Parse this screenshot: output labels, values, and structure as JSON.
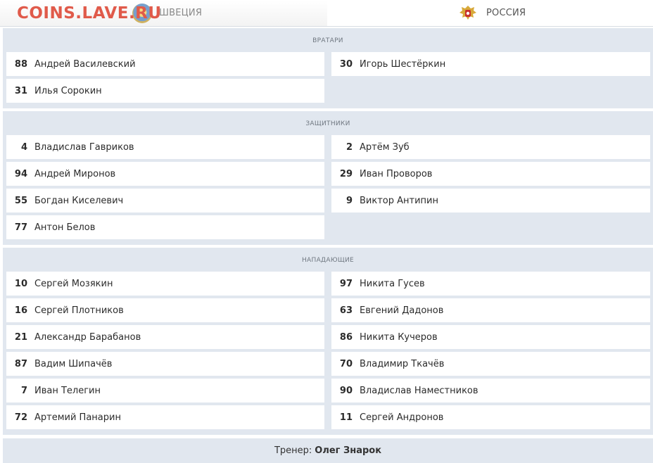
{
  "watermark": "COINS.LAVE.RU",
  "teams": {
    "left": {
      "name": "ШВЕЦИЯ",
      "icon": "sweden-emblem-icon"
    },
    "right": {
      "name": "РОССИЯ",
      "icon": "russia-emblem-icon"
    }
  },
  "sections": [
    {
      "title": "ВРАТАРИ",
      "left": [
        {
          "num": "88",
          "name": "Андрей Василевский"
        },
        {
          "num": "31",
          "name": "Илья Сорокин"
        }
      ],
      "right": [
        {
          "num": "30",
          "name": "Игорь Шестёркин"
        }
      ]
    },
    {
      "title": "ЗАЩИТНИКИ",
      "left": [
        {
          "num": "4",
          "name": "Владислав Гавриков"
        },
        {
          "num": "94",
          "name": "Андрей Миронов"
        },
        {
          "num": "55",
          "name": "Богдан Киселевич"
        },
        {
          "num": "77",
          "name": "Антон Белов"
        }
      ],
      "right": [
        {
          "num": "2",
          "name": "Артём Зуб"
        },
        {
          "num": "29",
          "name": "Иван Проворов"
        },
        {
          "num": "9",
          "name": "Виктор Антипин"
        }
      ]
    },
    {
      "title": "НАПАДАЮЩИЕ",
      "left": [
        {
          "num": "10",
          "name": "Сергей Мозякин"
        },
        {
          "num": "16",
          "name": "Сергей Плотников"
        },
        {
          "num": "21",
          "name": "Александр Барабанов"
        },
        {
          "num": "87",
          "name": "Вадим Шипачёв"
        },
        {
          "num": "7",
          "name": "Иван Телегин"
        },
        {
          "num": "72",
          "name": "Артемий Панарин"
        }
      ],
      "right": [
        {
          "num": "97",
          "name": "Никита Гусев"
        },
        {
          "num": "63",
          "name": "Евгений Дадонов"
        },
        {
          "num": "86",
          "name": "Никита Кучеров"
        },
        {
          "num": "70",
          "name": "Владимир Ткачёв"
        },
        {
          "num": "90",
          "name": "Владислав Наместников"
        },
        {
          "num": "11",
          "name": "Сергей Андронов"
        }
      ]
    }
  ],
  "coach": {
    "label": "Тренер:",
    "name": "Олег Знарок"
  },
  "colors": {
    "section_bg": "#e1e7ef",
    "row_bg": "#ffffff",
    "watermark": "#e05a4a"
  }
}
